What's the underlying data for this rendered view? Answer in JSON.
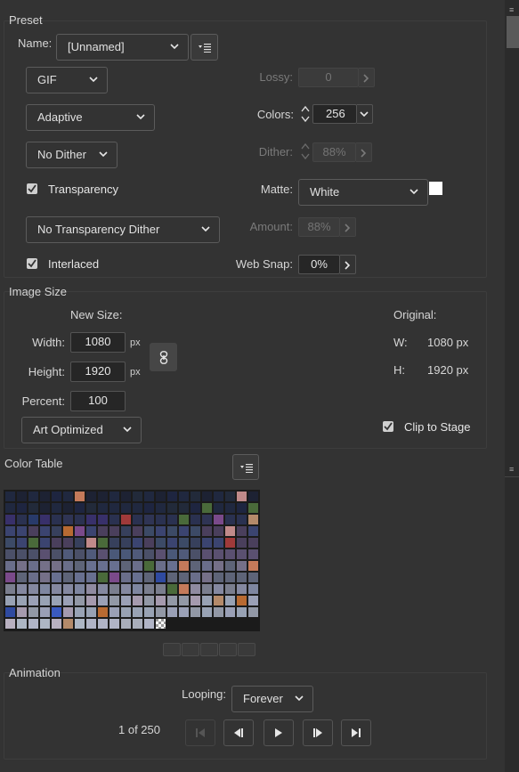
{
  "preset": {
    "title": "Preset",
    "name_label": "Name:",
    "name_value": "[Unnamed]",
    "format": "GIF",
    "palette": "Adaptive",
    "dither_mode": "No Dither",
    "transparency_label": "Transparency",
    "transparency_checked": true,
    "transparency_dither": "No Transparency Dither",
    "interlaced_label": "Interlaced",
    "interlaced_checked": true,
    "lossy_label": "Lossy:",
    "lossy_value": "0",
    "colors_label": "Colors:",
    "colors_value": "256",
    "dither_label": "Dither:",
    "dither_value": "88%",
    "matte_label": "Matte:",
    "matte_value": "White",
    "matte_color": "#ffffff",
    "amount_label": "Amount:",
    "amount_value": "88%",
    "websnap_label": "Web Snap:",
    "websnap_value": "0%"
  },
  "image_size": {
    "title": "Image Size",
    "new_size_label": "New Size:",
    "width_label": "Width:",
    "width_value": "1080",
    "height_label": "Height:",
    "height_value": "1920",
    "percent_label": "Percent:",
    "percent_value": "100",
    "unit": "px",
    "quality": "Art Optimized",
    "original_label": "Original:",
    "orig_w_label": "W:",
    "orig_w_value": "1080 px",
    "orig_h_label": "H:",
    "orig_h_value": "1920 px",
    "clip_label": "Clip to Stage",
    "clip_checked": true
  },
  "color_table": {
    "title": "Color Table",
    "icons": [
      "snap-to-web-icon",
      "cube-icon",
      "lock-icon",
      "new-color-icon",
      "trash-icon"
    ]
  },
  "animation": {
    "title": "Animation",
    "looping_label": "Looping:",
    "looping_value": "Forever",
    "frame_counter": "1 of 250"
  },
  "colors": {
    "background": "#333333",
    "border": "#5b5b5b",
    "text": "#d6d6d6",
    "disabled_text": "#747474"
  }
}
